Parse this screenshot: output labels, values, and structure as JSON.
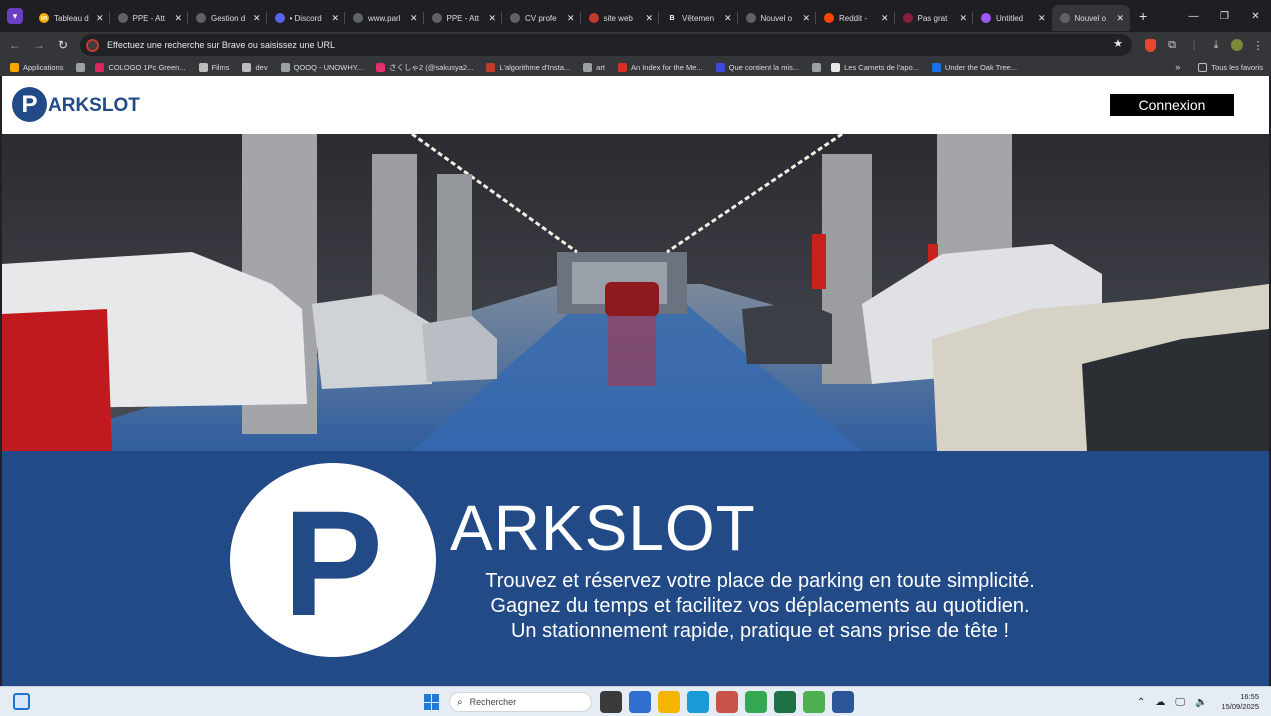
{
  "browser": {
    "tabs": [
      {
        "title": "Tableau d",
        "favicon_color": "#f2a900",
        "favicon_glyph": "in"
      },
      {
        "title": "PPE - Att",
        "favicon_color": "#5f6368",
        "favicon_glyph": ""
      },
      {
        "title": "Gestion d",
        "favicon_color": "#5f6368",
        "favicon_glyph": ""
      },
      {
        "title": "• Discord",
        "favicon_color": "#5865f2",
        "favicon_glyph": ""
      },
      {
        "title": "www.parl",
        "favicon_color": "#5f6368",
        "favicon_glyph": ""
      },
      {
        "title": "PPE - Att",
        "favicon_color": "#5f6368",
        "favicon_glyph": ""
      },
      {
        "title": "CV profe",
        "favicon_color": "#5f6368",
        "favicon_glyph": ""
      },
      {
        "title": "site web",
        "favicon_color": "#c2392e",
        "favicon_glyph": ""
      },
      {
        "title": "Vêtemen",
        "favicon_color": "#202124",
        "favicon_glyph": "B"
      },
      {
        "title": "Nouvel o",
        "favicon_color": "#5f6368",
        "favicon_glyph": ""
      },
      {
        "title": "Reddit -",
        "favicon_color": "#ff4500",
        "favicon_glyph": ""
      },
      {
        "title": "Pas grat",
        "favicon_color": "#8a1f3d",
        "favicon_glyph": ""
      },
      {
        "title": "Untitled",
        "favicon_color": "#a259ff",
        "favicon_glyph": ""
      },
      {
        "title": "Nouvel o",
        "favicon_color": "#5f6368",
        "favicon_glyph": "",
        "active": true
      }
    ],
    "omnibox_placeholder": "Effectuez une recherche sur Brave ou saisissez une URL",
    "bookmarks": [
      {
        "label": "Applications",
        "color": "#f2a900"
      },
      {
        "label": "",
        "color": "#9aa0a6"
      },
      {
        "label": "COLOGO 1Pc Green...",
        "color": "#e0245e"
      },
      {
        "label": "Films",
        "color": "#bdbdbd"
      },
      {
        "label": "dev",
        "color": "#bdbdbd"
      },
      {
        "label": "QOOQ - UNOWHY...",
        "color": "#9aa0a6"
      },
      {
        "label": "さくしゃ2 (@sakusya2...",
        "color": "#e1306c"
      },
      {
        "label": "L'algorithme d'Insta...",
        "color": "#c2392e"
      },
      {
        "label": "art",
        "color": "#9aa0a6"
      },
      {
        "label": "An Index for the Me...",
        "color": "#d93025"
      },
      {
        "label": "Que contient la mis...",
        "color": "#3c4bd6"
      },
      {
        "label": "",
        "color": "#9aa0a6"
      },
      {
        "label": "Les Carnets de l'apo...",
        "color": "#e8e8e8"
      },
      {
        "label": "Under the Oak Tree...",
        "color": "#1a73e8"
      }
    ],
    "bookmarks_all": "Tous les favoris"
  },
  "site": {
    "logo_letter": "P",
    "logo_text": "ARKSLOT",
    "login_label": "Connexion",
    "banner_letter": "P",
    "banner_title": "ARKSLOT",
    "tagline": [
      "Trouvez et réservez votre place de parking en toute simplicité.",
      "Gagnez du temps et facilitez vos déplacements au quotidien.",
      "Un stationnement rapide, pratique et sans prise de tête !"
    ],
    "brand_color": "#214a87"
  },
  "taskbar": {
    "search_placeholder": "Rechercher",
    "time": "16:55",
    "date": "15/09/2025",
    "apps": [
      {
        "name": "task-view",
        "color": "#3a3a3a"
      },
      {
        "name": "news",
        "color": "#2f6fd0"
      },
      {
        "name": "file-explorer",
        "color": "#f4b400"
      },
      {
        "name": "edge",
        "color": "#1a9bd7"
      },
      {
        "name": "store",
        "color": "#c8534a"
      },
      {
        "name": "chrome",
        "color": "#34a853"
      },
      {
        "name": "excel",
        "color": "#1e7145"
      },
      {
        "name": "paint",
        "color": "#4caf50"
      },
      {
        "name": "word",
        "color": "#2b579a"
      }
    ]
  }
}
